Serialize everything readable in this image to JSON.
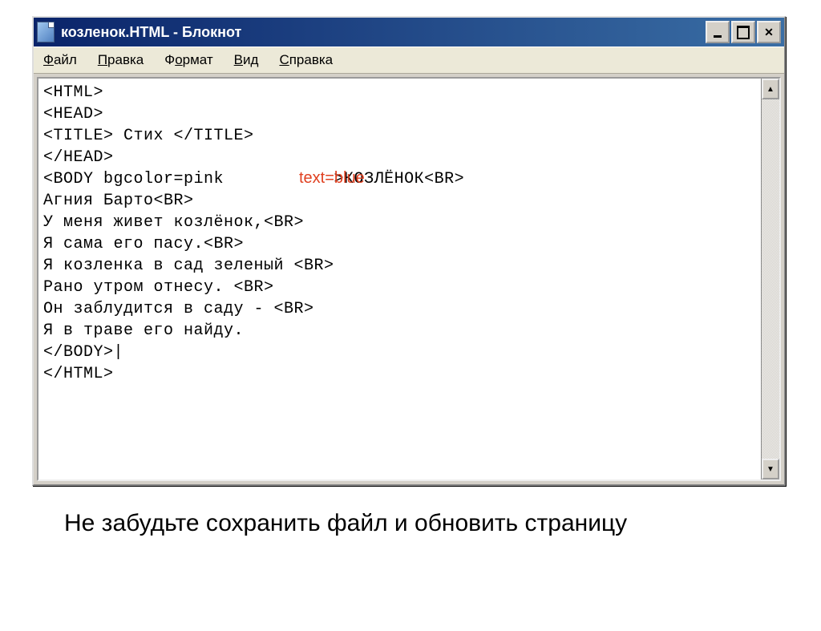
{
  "window": {
    "title": "козленок.HTML - Блокнот"
  },
  "menu": {
    "file": {
      "ul": "Ф",
      "rest": "айл"
    },
    "edit": {
      "ul": "П",
      "rest": "равка"
    },
    "format": {
      "pre": "Ф",
      "ul": "о",
      "rest": "рмат"
    },
    "view": {
      "ul": "В",
      "rest": "ид"
    },
    "help": {
      "ul": "С",
      "rest": "правка"
    }
  },
  "content": {
    "lines": [
      "<HTML>",
      "<HEAD>",
      "<TITLE> Стих </TITLE>",
      "</HEAD>",
      "<BODY bgcolor=pink           >КОЗЛЁНОК<BR>",
      "Агния Барто<BR>",
      "У меня живет козлёнок,<BR>",
      "Я сама его пасу.<BR>",
      "Я козленка в сад зеленый <BR>",
      "Рано утром отнесу. <BR>",
      "Он заблудится в саду - <BR>",
      "Я в траве его найду.",
      "</BODY>|",
      "</HTML>"
    ]
  },
  "annotation": "text=blue",
  "caption": "Не забудьте сохранить файл и обновить страницу"
}
